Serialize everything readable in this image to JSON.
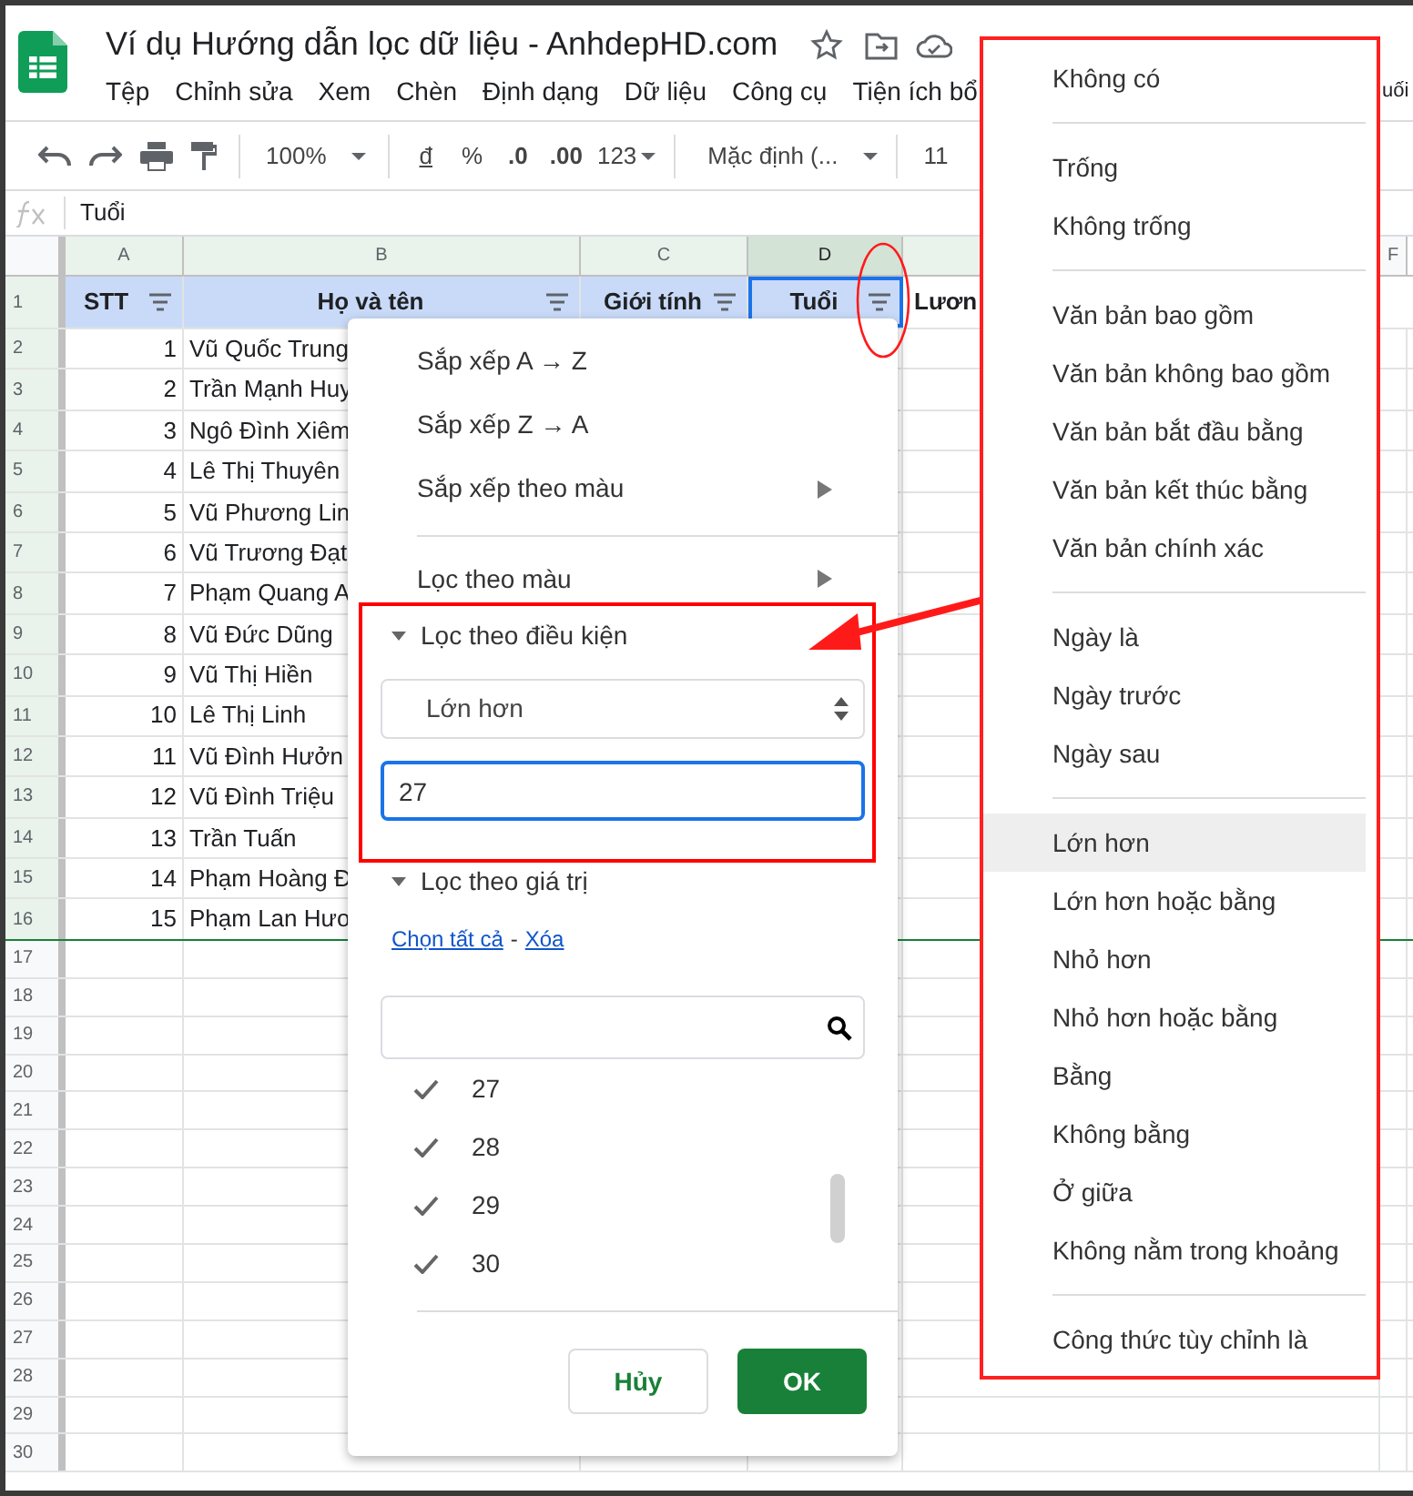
{
  "document": {
    "title": "Ví dụ Hướng dẫn lọc dữ liệu - AnhdepHD.com",
    "menu": [
      "Tệp",
      "Chỉnh sửa",
      "Xem",
      "Chèn",
      "Định dạng",
      "Dữ liệu",
      "Công cụ",
      "Tiện ích bổ"
    ],
    "menu_fragment": "uối"
  },
  "toolbar": {
    "zoom": "100%",
    "currency": "đ",
    "percent": "%",
    "decrease_decimals": ".0",
    "increase_decimals": ".00",
    "number_format": "123",
    "font": "Mặc định (...",
    "font_size": "11"
  },
  "formula_bar": {
    "value": "Tuổi"
  },
  "sheet": {
    "columns": [
      {
        "label": "A",
        "selected": false
      },
      {
        "label": "B",
        "selected": false
      },
      {
        "label": "C",
        "selected": false
      },
      {
        "label": "D",
        "selected": true
      },
      {
        "selected": false
      },
      {
        "label": "F",
        "selected": false
      }
    ],
    "header_row": [
      "STT",
      "Họ và tên",
      "Giới tính",
      "Tuổi",
      "Lươn"
    ],
    "rows": [
      {
        "stt": "1",
        "name": "Vũ Quốc Trung"
      },
      {
        "stt": "2",
        "name": "Trần Mạnh Huy"
      },
      {
        "stt": "3",
        "name": "Ngô Đình Xiêm"
      },
      {
        "stt": "4",
        "name": "Lê Thị Thuyên"
      },
      {
        "stt": "5",
        "name": "Vũ Phương Lin"
      },
      {
        "stt": "6",
        "name": "Vũ Trương Đạt"
      },
      {
        "stt": "7",
        "name": "Phạm Quang A"
      },
      {
        "stt": "8",
        "name": "Vũ Đức Dũng"
      },
      {
        "stt": "9",
        "name": "Vũ Thị Hiền"
      },
      {
        "stt": "10",
        "name": "Lê Thị Linh"
      },
      {
        "stt": "11",
        "name": "Vũ Đình Hưởn"
      },
      {
        "stt": "12",
        "name": "Vũ Đình Triệu"
      },
      {
        "stt": "13",
        "name": "Trần Tuấn"
      },
      {
        "stt": "14",
        "name": "Phạm Hoàng Đ"
      },
      {
        "stt": "15",
        "name": "Phạm Lan Hươ"
      }
    ],
    "row_numbers": [
      "1",
      "2",
      "3",
      "4",
      "5",
      "6",
      "7",
      "8",
      "9",
      "10",
      "11",
      "12",
      "13",
      "14",
      "15",
      "16",
      "17",
      "18",
      "19",
      "20",
      "21",
      "22",
      "23",
      "24",
      "25",
      "26",
      "27",
      "28",
      "29",
      "30"
    ]
  },
  "filter_menu": {
    "sort_items": [
      {
        "label": "Sắp xếp A → Z",
        "submenu": false
      },
      {
        "label": "Sắp xếp Z → A",
        "submenu": false
      },
      {
        "label": "Sắp xếp theo màu",
        "submenu": true
      }
    ],
    "color_filter": {
      "label": "Lọc theo màu",
      "submenu": true
    },
    "condition": {
      "title": "Lọc theo điều kiện",
      "expanded": true,
      "selected_condition": "Lớn hơn",
      "value": "27"
    },
    "values": {
      "title": "Lọc theo giá trị",
      "expanded": true,
      "select_all": "Chọn tất cả",
      "separator": "-",
      "clear": "Xóa",
      "items": [
        {
          "label": "27",
          "checked": true
        },
        {
          "label": "28",
          "checked": true
        },
        {
          "label": "29",
          "checked": true
        },
        {
          "label": "30",
          "checked": true
        }
      ]
    },
    "buttons": {
      "cancel": "Hủy",
      "ok": "OK"
    }
  },
  "condition_menu": {
    "groups": [
      [
        {
          "label": "Không có",
          "selected": false
        }
      ],
      [
        {
          "label": "Trống",
          "selected": false
        },
        {
          "label": "Không trống",
          "selected": false
        }
      ],
      [
        {
          "label": "Văn bản bao gồm",
          "selected": false
        },
        {
          "label": "Văn bản không bao gồm",
          "selected": false
        },
        {
          "label": "Văn bản bắt đầu bằng",
          "selected": false
        },
        {
          "label": "Văn bản kết thúc bằng",
          "selected": false
        },
        {
          "label": "Văn bản chính xác",
          "selected": false
        }
      ],
      [
        {
          "label": "Ngày là",
          "selected": false
        },
        {
          "label": "Ngày trước",
          "selected": false
        },
        {
          "label": "Ngày sau",
          "selected": false
        }
      ],
      [
        {
          "label": "Lớn hơn",
          "selected": true
        },
        {
          "label": "Lớn hơn hoặc bằng",
          "selected": false
        },
        {
          "label": "Nhỏ hơn",
          "selected": false
        },
        {
          "label": "Nhỏ hơn hoặc bằng",
          "selected": false
        },
        {
          "label": "Bằng",
          "selected": false
        },
        {
          "label": "Không bằng",
          "selected": false
        },
        {
          "label": "Ở giữa",
          "selected": false
        },
        {
          "label": "Không nằm trong khoảng",
          "selected": false
        }
      ],
      [
        {
          "label": "Công thức tùy chỉnh là",
          "selected": false
        }
      ]
    ]
  }
}
